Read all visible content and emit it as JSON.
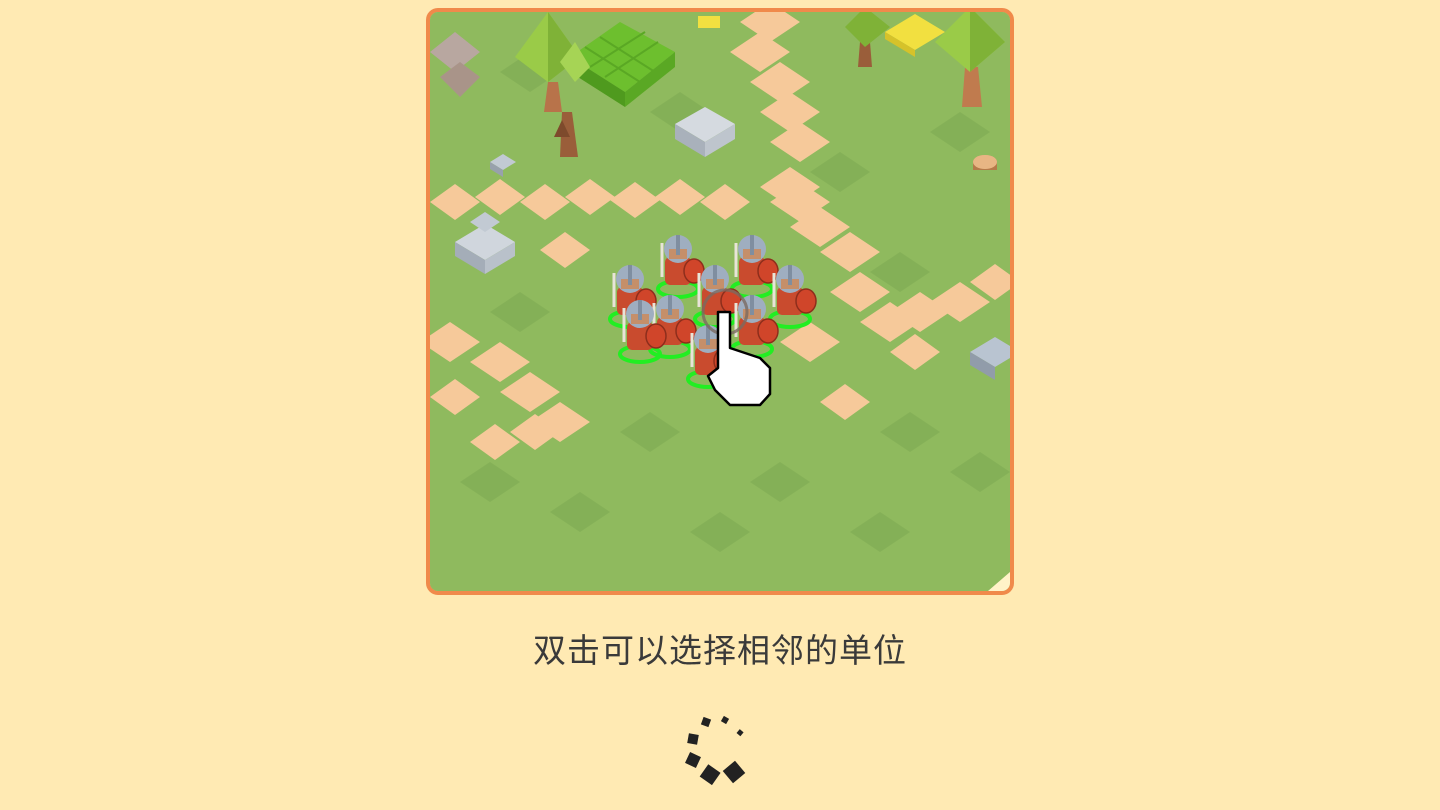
{
  "tutorial": {
    "caption": "双击可以选择相邻的单位",
    "scene": {
      "palette": {
        "grass": "#8FBA5E",
        "grass_dark": "#83AF55",
        "path": "#F6C99A",
        "frame": "#F08A4B",
        "soldier_armor": "#C94B2E",
        "helmet": "#9FAEC0",
        "selection_ring": "#22EE22",
        "hand": "#FFFFFF"
      },
      "selected_units": 9,
      "icons": [
        "tap-hand-icon",
        "soldier-unit-icon",
        "tree-icon",
        "rock-icon",
        "bush-block-icon"
      ]
    }
  },
  "loading": {
    "icon": "loading-spinner-icon",
    "color": "#222222"
  }
}
